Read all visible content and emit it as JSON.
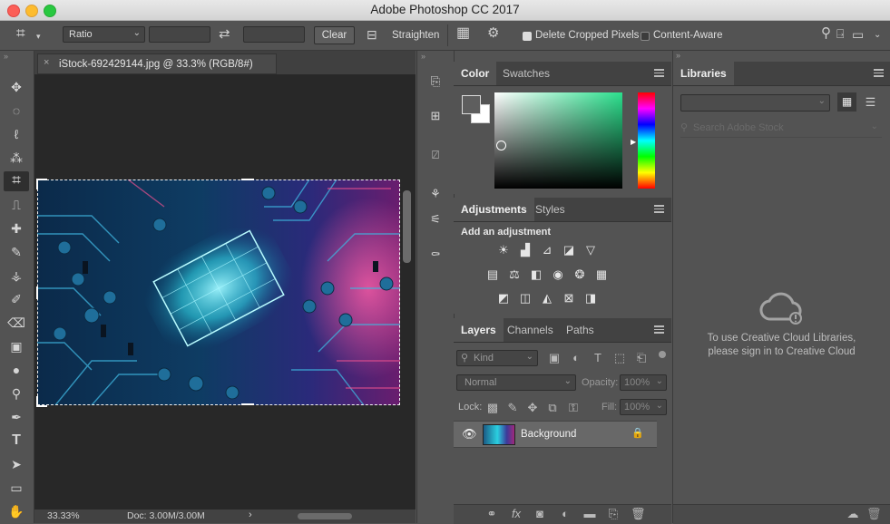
{
  "window": {
    "title": "Adobe Photoshop CC 2017"
  },
  "options_bar": {
    "ratio_select": "Ratio",
    "clear_label": "Clear",
    "straighten_label": "Straighten",
    "delete_cropped_label": "Delete Cropped Pixels",
    "delete_cropped_checked": true,
    "content_aware_label": "Content-Aware",
    "content_aware_checked": false
  },
  "document": {
    "tab_title": "iStock-692429144.jpg @ 33.3% (RGB/8#)",
    "zoom": "33.33%",
    "doc_size": "Doc: 3.00M/3.00M"
  },
  "color_panel": {
    "tabs": [
      "Color",
      "Swatches"
    ],
    "active_tab": "Color"
  },
  "adjustments_panel": {
    "tabs": [
      "Adjustments",
      "Styles"
    ],
    "active_tab": "Adjustments",
    "heading": "Add an adjustment"
  },
  "layers_panel": {
    "tabs": [
      "Layers",
      "Channels",
      "Paths"
    ],
    "active_tab": "Layers",
    "filter_kind": "Kind",
    "blend_mode": "Normal",
    "opacity_label": "Opacity:",
    "opacity_value": "100%",
    "lock_label": "Lock:",
    "fill_label": "Fill:",
    "fill_value": "100%",
    "layers": [
      {
        "name": "Background",
        "visible": true,
        "locked": true
      }
    ]
  },
  "libraries_panel": {
    "tab": "Libraries",
    "search_placeholder": "Search Adobe Stock",
    "message_line1": "To use Creative Cloud Libraries,",
    "message_line2": "please sign in to Creative Cloud"
  }
}
